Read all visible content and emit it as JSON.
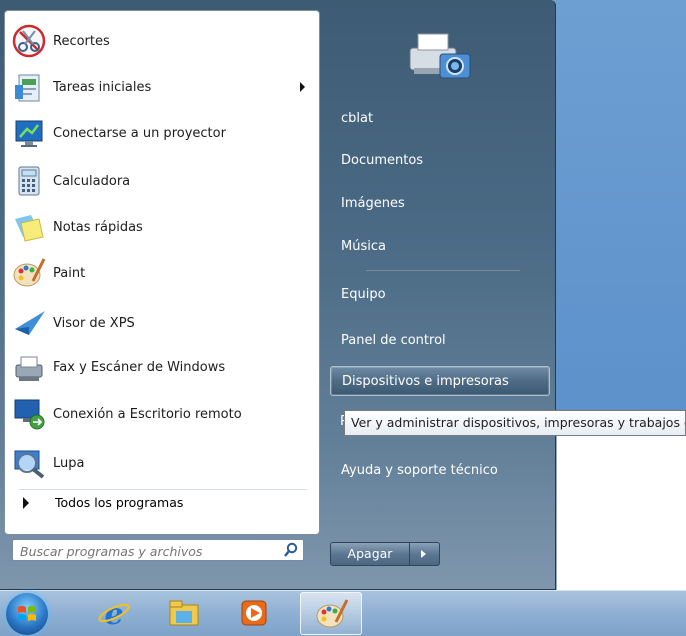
{
  "programs": [
    {
      "label": "Recortes",
      "icon": "scissors-icon"
    },
    {
      "label": "Tareas iniciales",
      "icon": "getting-started-icon",
      "has_submenu": true
    },
    {
      "label": "Conectarse a un proyector",
      "icon": "projector-icon"
    },
    {
      "label": "Calculadora",
      "icon": "calculator-icon"
    },
    {
      "label": "Notas rápidas",
      "icon": "sticky-notes-icon"
    },
    {
      "label": "Paint",
      "icon": "paint-palette-icon"
    },
    {
      "label": "Visor de XPS",
      "icon": "xps-viewer-icon"
    },
    {
      "label": "Fax y Escáner de Windows",
      "icon": "fax-scanner-icon"
    },
    {
      "label": "Conexión a Escritorio remoto",
      "icon": "remote-desktop-icon"
    },
    {
      "label": "Lupa",
      "icon": "magnifier-icon"
    }
  ],
  "all_programs_label": "Todos los programas",
  "search": {
    "placeholder": "Buscar programas y archivos"
  },
  "right_items": [
    {
      "label": "cblat"
    },
    {
      "label": "Documentos"
    },
    {
      "label": "Imágenes"
    },
    {
      "label": "Música"
    },
    {
      "label": "Equipo"
    },
    {
      "label": "Panel de control"
    },
    {
      "label": "Dispositivos e impresoras",
      "highlighted": true
    },
    {
      "label": "Programas predeterminados",
      "obscured": true
    },
    {
      "label": "Ayuda y soporte técnico"
    }
  ],
  "tooltip": "Ver y administrar dispositivos, impresoras y trabajos de impresión",
  "shutdown_label": "Apagar",
  "taskbar_items": [
    "ie-icon",
    "explorer-icon",
    "media-player-icon",
    "paint-icon"
  ],
  "colors": {
    "accent": "#3e5b74",
    "taskbar": "#8fb0d2"
  }
}
